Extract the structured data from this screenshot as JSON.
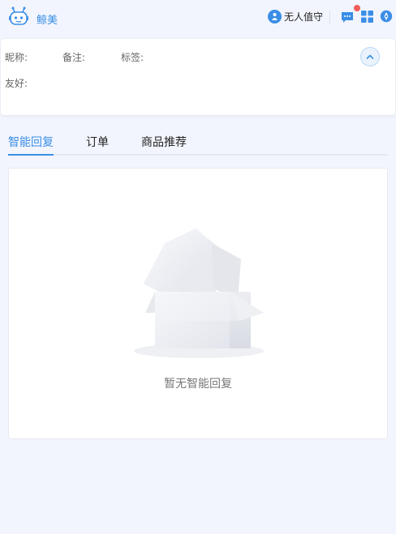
{
  "header": {
    "app_name": "鲸美",
    "status_text": "无人值守"
  },
  "info": {
    "nickname_label": "昵称:",
    "remark_label": "备注:",
    "tag_label": "标签:",
    "friend_label": "友好:"
  },
  "tabs": [
    {
      "label": "智能回复",
      "active": true
    },
    {
      "label": "订单",
      "active": false
    },
    {
      "label": "商品推荐",
      "active": false
    }
  ],
  "empty": {
    "text": "暂无智能回复"
  },
  "colors": {
    "accent": "#3a8ee6",
    "badge": "#f25c5c",
    "background": "#f2f5fd"
  }
}
